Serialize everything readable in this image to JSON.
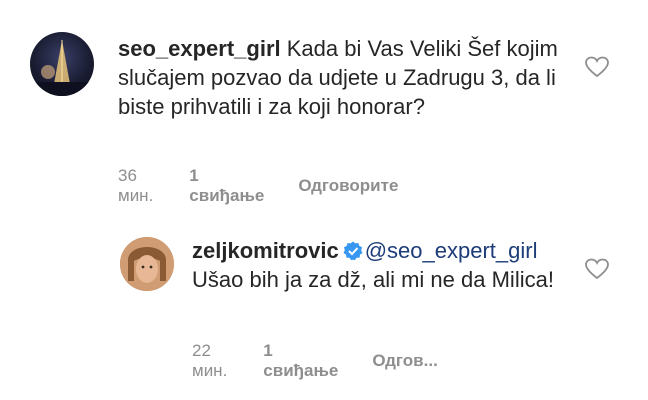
{
  "comments": [
    {
      "username": "seo_expert_girl",
      "text": " Kada bi Vas Veliki Šef kojim slučajem pozvao da udjete u Zadrugu 3, da li biste prihvatili i za koji honorar?",
      "age": "36 мин.",
      "likes": "1 свиђање",
      "reply": "Одговорите"
    },
    {
      "username": "zeljkomitrovic",
      "mention": "@seo_expert_girl",
      "text": " Ušao bih ja za dž, ali mi ne da Milica!",
      "age": "22 мин.",
      "likes": "1 свиђање",
      "reply": "Одгов..."
    }
  ],
  "colors": {
    "text": "#262626",
    "meta": "#8e8e8e",
    "mention": "#1d3c78",
    "verified": "#3897f0"
  },
  "icons": {
    "like": "heart-outline-icon",
    "verified": "verified-badge-icon"
  }
}
